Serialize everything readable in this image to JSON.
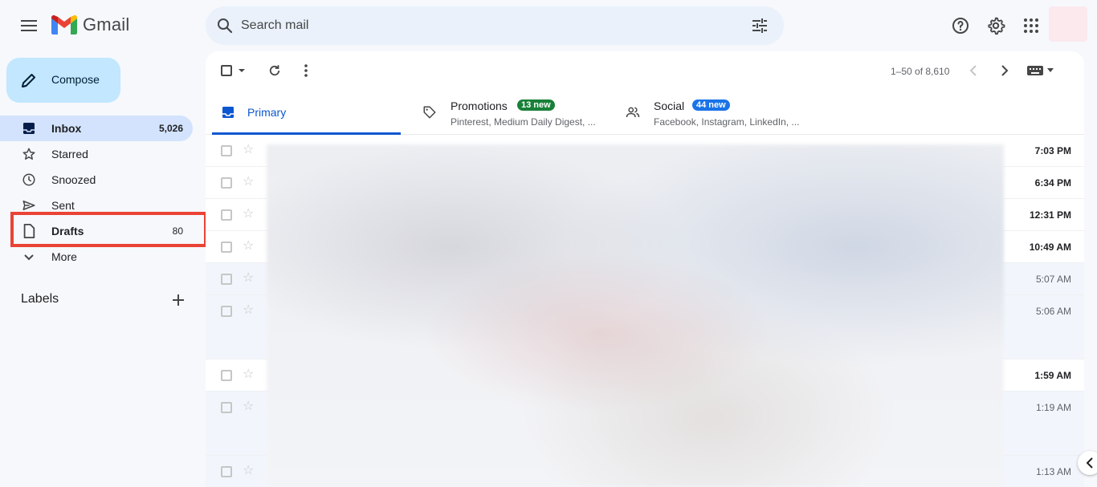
{
  "app": {
    "name": "Gmail"
  },
  "search": {
    "placeholder": "Search mail"
  },
  "compose": {
    "label": "Compose"
  },
  "nav": [
    {
      "id": "inbox",
      "label": "Inbox",
      "count": "5,026",
      "icon": "inbox-icon"
    },
    {
      "id": "starred",
      "label": "Starred",
      "count": "",
      "icon": "star-icon"
    },
    {
      "id": "snoozed",
      "label": "Snoozed",
      "count": "",
      "icon": "clock-icon"
    },
    {
      "id": "sent",
      "label": "Sent",
      "count": "",
      "icon": "send-icon"
    },
    {
      "id": "drafts",
      "label": "Drafts",
      "count": "80",
      "icon": "draft-icon"
    },
    {
      "id": "more",
      "label": "More",
      "count": "",
      "icon": "chevron-down-icon"
    }
  ],
  "labels": {
    "title": "Labels"
  },
  "toolbar": {
    "pager": "1–50 of 8,610"
  },
  "tabs": {
    "primary": {
      "label": "Primary"
    },
    "promotions": {
      "label": "Promotions",
      "badge": "13 new",
      "sub": "Pinterest, Medium Daily Digest, ..."
    },
    "social": {
      "label": "Social",
      "badge": "44 new",
      "sub": "Facebook, Instagram, LinkedIn, ..."
    }
  },
  "emails": [
    {
      "time": "7:03 PM",
      "unread": true
    },
    {
      "time": "6:34 PM",
      "unread": true
    },
    {
      "time": "12:31 PM",
      "unread": true
    },
    {
      "time": "10:49 AM",
      "unread": true
    },
    {
      "time": "5:07 AM",
      "unread": false
    },
    {
      "time": "5:06 AM",
      "unread": false
    },
    {
      "time": "1:59 AM",
      "unread": true
    },
    {
      "time": "1:19 AM",
      "unread": false
    },
    {
      "time": "1:13 AM",
      "unread": false
    }
  ],
  "colors": {
    "accent": "#0b57d0",
    "compose_bg": "#c2e7ff",
    "active_nav": "#d3e3fd",
    "promo_badge": "#188038",
    "social_badge": "#1a73e8",
    "highlight": "#ea4335"
  }
}
